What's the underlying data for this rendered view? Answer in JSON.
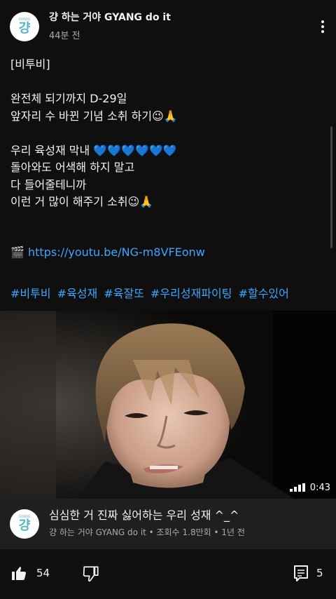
{
  "post": {
    "channel_name": "걍 하는 거야 GYANG do it",
    "time": "44분 전",
    "avatar_text": "걍",
    "avatar_small": "GYANG",
    "lines": [
      "[비투비]",
      "",
      "완전체 되기까지 D-29일",
      "앞자리 수 바뀐 기념 소취 하기😉🙏",
      "",
      "우리 육성재 막내 💙💙💙💙💙💙",
      "돌아와도 어색해 하지 말고",
      "다 들어줄테니까",
      "이런 거 많이 해주기 소취😉🙏",
      "",
      ""
    ],
    "link_icon": "🎬",
    "link_text": "https://youtu.be/NG-m8VFEonw",
    "hashtags": [
      "#비투비",
      "#육성재",
      "#육잘또",
      "#우리성재파이팅",
      "#할수있어"
    ]
  },
  "video": {
    "duration": "0:43",
    "title": "심심한 거 진짜 싫어하는 우리 성재 ^_^",
    "meta": "걍 하는 거야 GYANG do it • 조회수 1.8만회 • 1년 전"
  },
  "actions": {
    "like_count": "54",
    "comment_count": "5"
  },
  "colors": {
    "background": "#0f0f0f",
    "link": "#3ea6ff",
    "card": "#1f1f1f",
    "secondary_text": "#aaaaaa"
  }
}
